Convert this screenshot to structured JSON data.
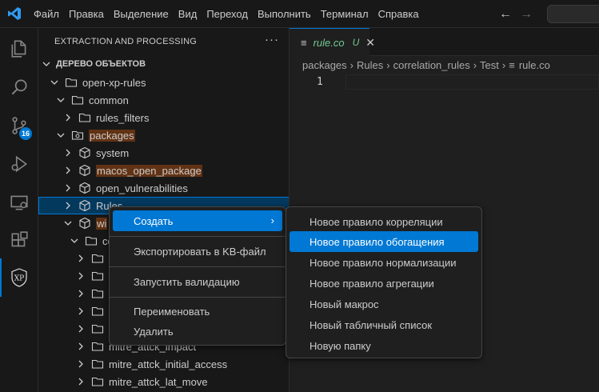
{
  "colors": {
    "accent": "#0078d4",
    "highlight": "#613214",
    "git_added": "#73c991"
  },
  "menu": [
    "Файл",
    "Правка",
    "Выделение",
    "Вид",
    "Переход",
    "Выполнить",
    "Терминал",
    "Справка"
  ],
  "nav": {
    "back_icon": "arrow-left-icon",
    "forward_icon": "arrow-right-icon"
  },
  "activity": {
    "items": [
      "explorer-icon",
      "search-icon",
      "source-control-icon",
      "run-debug-icon",
      "remote-explorer-icon",
      "extensions-icon",
      "xp-extension-icon"
    ],
    "source_control_badge": "16",
    "xp_label": "XP"
  },
  "sidebar": {
    "title": "EXTRACTION AND PROCESSING",
    "more": "···",
    "section": "ДЕРЕВО ОБЪЕКТОВ",
    "tree": [
      {
        "label": "open-xp-rules"
      },
      {
        "label": "common"
      },
      {
        "label": "rules_filters"
      },
      {
        "label": "packages"
      },
      {
        "label": "system"
      },
      {
        "label": "macos_open_package"
      },
      {
        "label": "open_vulnerabilities"
      },
      {
        "label": "Rules"
      },
      {
        "label": "wi"
      },
      {
        "label": "co"
      },
      {
        "label": "mitre_attck_impact"
      },
      {
        "label": "mitre_attck_initial_access"
      },
      {
        "label": "mitre_attck_lat_move"
      }
    ]
  },
  "editor": {
    "tab": {
      "label": "rule.co",
      "status": "U",
      "close": "✕"
    },
    "breadcrumb": [
      "packages",
      "Rules",
      "correlation_rules",
      "Test",
      "rule.co"
    ],
    "line_numbers": [
      "1"
    ]
  },
  "context_menu": {
    "items": [
      "Создать",
      "Экспортировать в KB-файл",
      "Запустить валидацию",
      "Переименовать",
      "Удалить"
    ],
    "submenu_arrow": "›"
  },
  "submenu": {
    "items": [
      "Новое правило корреляции",
      "Новое правило обогащения",
      "Новое правило нормализации",
      "Новое правило агрегации",
      "Новый макрос",
      "Новый табличный список",
      "Новую папку"
    ]
  }
}
